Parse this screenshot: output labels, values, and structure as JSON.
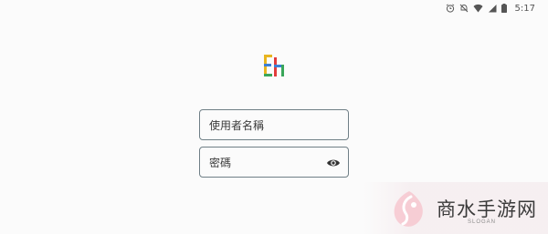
{
  "status_bar": {
    "time": "5:17",
    "icons": [
      "alarm-icon",
      "mute-icon",
      "wifi-icon",
      "signal-icon",
      "battery-icon"
    ]
  },
  "logo": {
    "icon": "app-logo-icon",
    "colors": [
      "#e8b520",
      "#3c7fd6",
      "#e23c3c",
      "#3aa65a"
    ]
  },
  "form": {
    "username_placeholder": "使用者名稱",
    "password_placeholder": "密碼",
    "password_toggle_icon": "eye-icon",
    "border_color": "#6f7f86"
  },
  "watermark": {
    "text": "商水手游网",
    "subtext": "SLOGAN",
    "accent_color": "#f3a6b4"
  }
}
